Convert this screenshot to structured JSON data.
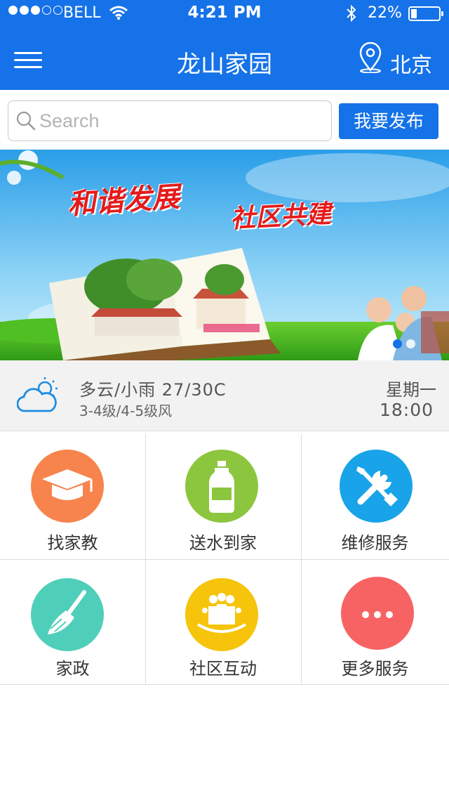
{
  "status_bar": {
    "carrier": "BELL",
    "time": "4:21 PM",
    "battery": "22%",
    "battery_level": 0.22,
    "signal_bars": 3,
    "signal_total": 5
  },
  "nav": {
    "title": "龙山家园",
    "city": "北京"
  },
  "search": {
    "placeholder": "Search",
    "value": ""
  },
  "publish_button": "我要发布",
  "banner": {
    "slogan_left": "和谐发展",
    "slogan_right": "社区共建",
    "page_count": 2,
    "active_page": 1
  },
  "weather": {
    "description": "多云/小雨  27/30C",
    "wind": "3-4级/4-5级风",
    "weekday": "星期一",
    "time": "18:00"
  },
  "services": [
    {
      "label": "找家教",
      "icon": "graduation-cap-icon",
      "color": "#f7844d"
    },
    {
      "label": "送水到家",
      "icon": "water-bottle-icon",
      "color": "#8cc63e"
    },
    {
      "label": "维修服务",
      "icon": "wrench-screwdriver-icon",
      "color": "#19a3e8"
    },
    {
      "label": "家政",
      "icon": "broom-icon",
      "color": "#4fcfb9"
    },
    {
      "label": "社区互动",
      "icon": "people-group-icon",
      "color": "#f5c40b"
    },
    {
      "label": "更多服务",
      "icon": "more-dots-icon",
      "color": "#f76363"
    }
  ],
  "colors": {
    "primary": "#1572e8",
    "weather_bg": "#f2f2f2"
  }
}
